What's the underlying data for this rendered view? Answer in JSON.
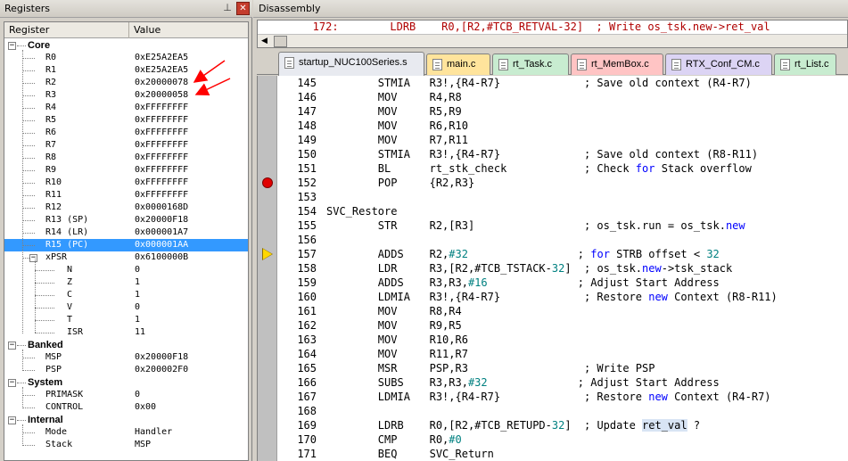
{
  "registers_panel": {
    "title": "Registers",
    "pin_icon": "pin-icon",
    "close_icon": "close-icon",
    "col_register": "Register",
    "col_value": "Value",
    "groups": [
      {
        "name": "Core",
        "expander": "−",
        "rows": [
          {
            "name": "R0",
            "value": "0xE25A2EA5"
          },
          {
            "name": "R1",
            "value": "0xE25A2EA5"
          },
          {
            "name": "R2",
            "value": "0x20000078"
          },
          {
            "name": "R3",
            "value": "0x20000058"
          },
          {
            "name": "R4",
            "value": "0xFFFFFFFF"
          },
          {
            "name": "R5",
            "value": "0xFFFFFFFF"
          },
          {
            "name": "R6",
            "value": "0xFFFFFFFF"
          },
          {
            "name": "R7",
            "value": "0xFFFFFFFF"
          },
          {
            "name": "R8",
            "value": "0xFFFFFFFF"
          },
          {
            "name": "R9",
            "value": "0xFFFFFFFF"
          },
          {
            "name": "R10",
            "value": "0xFFFFFFFF"
          },
          {
            "name": "R11",
            "value": "0xFFFFFFFF"
          },
          {
            "name": "R12",
            "value": "0x0000168D"
          },
          {
            "name": "R13 (SP)",
            "value": "0x20000F18"
          },
          {
            "name": "R14 (LR)",
            "value": "0x000001A7"
          },
          {
            "name": "R15 (PC)",
            "value": "0x000001AA",
            "selected": true
          },
          {
            "name": "xPSR",
            "value": "0x6100000B",
            "expander": "−"
          }
        ],
        "xpsr_bits": [
          {
            "name": "N",
            "value": "0"
          },
          {
            "name": "Z",
            "value": "1"
          },
          {
            "name": "C",
            "value": "1"
          },
          {
            "name": "V",
            "value": "0"
          },
          {
            "name": "T",
            "value": "1"
          },
          {
            "name": "ISR",
            "value": "11"
          }
        ]
      },
      {
        "name": "Banked",
        "expander": "−",
        "rows": [
          {
            "name": "MSP",
            "value": "0x20000F18"
          },
          {
            "name": "PSP",
            "value": "0x200002F0"
          }
        ]
      },
      {
        "name": "System",
        "expander": "−",
        "rows": [
          {
            "name": "PRIMASK",
            "value": "0"
          },
          {
            "name": "CONTROL",
            "value": "0x00"
          }
        ]
      },
      {
        "name": "Internal",
        "expander": "−",
        "rows": [
          {
            "name": "Mode",
            "value": "Handler"
          },
          {
            "name": "Stack",
            "value": "MSP"
          }
        ]
      }
    ],
    "annotation_color": "#ff0000"
  },
  "disassembly_panel": {
    "title": "Disassembly",
    "top_line": "   172:        LDRB    R0,[R2,#TCB_RETVAL-32]  ; Write os_tsk.new->ret_val",
    "tabs": [
      {
        "label": "startup_NUC100Series.s",
        "color": "#e8eaf0",
        "active": true
      },
      {
        "label": "main.c",
        "color": "#ffe49c"
      },
      {
        "label": "rt_Task.c",
        "color": "#c8ecd0"
      },
      {
        "label": "rt_MemBox.c",
        "color": "#ffc4c4"
      },
      {
        "label": "RTX_Conf_CM.c",
        "color": "#dcd4f4"
      },
      {
        "label": "rt_List.c",
        "color": "#c8ecd0"
      }
    ],
    "breakpoint_color": "#e00000",
    "current_line_color": "#ffd700",
    "lines": [
      {
        "n": "145",
        "code": [
          {
            "t": "        STMIA   R3!,{R4-R7}             ; Save old context (R4-R7)"
          }
        ]
      },
      {
        "n": "146",
        "code": [
          {
            "t": "        MOV     R4,R8"
          }
        ]
      },
      {
        "n": "147",
        "code": [
          {
            "t": "        MOV     R5,R9"
          }
        ]
      },
      {
        "n": "148",
        "code": [
          {
            "t": "        MOV     R6,R10"
          }
        ]
      },
      {
        "n": "149",
        "code": [
          {
            "t": "        MOV     R7,R11"
          }
        ]
      },
      {
        "n": "150",
        "code": [
          {
            "t": "        STMIA   R3!,{R4-R7}             ; Save old context (R8-R11)"
          }
        ]
      },
      {
        "n": "151",
        "code": [
          {
            "t": "        BL      rt_stk_check            ; Check "
          },
          {
            "t": "for",
            "c": "kw"
          },
          {
            "t": " Stack overflow"
          }
        ]
      },
      {
        "n": "152",
        "code": [
          {
            "t": "        POP     {R2,R3}"
          }
        ],
        "marker": "breakpoint"
      },
      {
        "n": "153",
        "code": [
          {
            "t": ""
          }
        ]
      },
      {
        "n": "154",
        "code": [
          {
            "t": "SVC_Restore"
          }
        ]
      },
      {
        "n": "155",
        "code": [
          {
            "t": "        STR     R2,[R3]                 ; os_tsk.run = os_tsk."
          },
          {
            "t": "new",
            "c": "kw"
          }
        ]
      },
      {
        "n": "156",
        "code": [
          {
            "t": ""
          }
        ]
      },
      {
        "n": "157",
        "code": [
          {
            "t": "        ADDS    R2,"
          },
          {
            "t": "#32",
            "c": "num"
          },
          {
            "t": "                 ; "
          },
          {
            "t": "for",
            "c": "kw"
          },
          {
            "t": " STRB offset < "
          },
          {
            "t": "32",
            "c": "num"
          }
        ],
        "marker": "current"
      },
      {
        "n": "158",
        "code": [
          {
            "t": "        LDR     R3,[R2,#TCB_TSTACK-"
          },
          {
            "t": "32",
            "c": "num"
          },
          {
            "t": "]  ; os_tsk."
          },
          {
            "t": "new",
            "c": "kw"
          },
          {
            "t": "->tsk_stack"
          }
        ]
      },
      {
        "n": "159",
        "code": [
          {
            "t": "        ADDS    R3,R3,"
          },
          {
            "t": "#16",
            "c": "num"
          },
          {
            "t": "              ; Adjust Start Address"
          }
        ]
      },
      {
        "n": "160",
        "code": [
          {
            "t": "        LDMIA   R3!,{R4-R7}             ; Restore "
          },
          {
            "t": "new",
            "c": "kw"
          },
          {
            "t": " Context (R8-R11)"
          }
        ]
      },
      {
        "n": "161",
        "code": [
          {
            "t": "        MOV     R8,R4"
          }
        ]
      },
      {
        "n": "162",
        "code": [
          {
            "t": "        MOV     R9,R5"
          }
        ]
      },
      {
        "n": "163",
        "code": [
          {
            "t": "        MOV     R10,R6"
          }
        ]
      },
      {
        "n": "164",
        "code": [
          {
            "t": "        MOV     R11,R7"
          }
        ]
      },
      {
        "n": "165",
        "code": [
          {
            "t": "        MSR     PSP,R3                  ; Write PSP"
          }
        ]
      },
      {
        "n": "166",
        "code": [
          {
            "t": "        SUBS    R3,R3,"
          },
          {
            "t": "#32",
            "c": "num"
          },
          {
            "t": "              ; Adjust Start Address"
          }
        ]
      },
      {
        "n": "167",
        "code": [
          {
            "t": "        LDMIA   R3!,{R4-R7}             ; Restore "
          },
          {
            "t": "new",
            "c": "kw"
          },
          {
            "t": " Context (R4-R7)"
          }
        ]
      },
      {
        "n": "168",
        "code": [
          {
            "t": ""
          }
        ]
      },
      {
        "n": "169",
        "code": [
          {
            "t": "        LDRB    R0,[R2,#TCB_RETUPD-"
          },
          {
            "t": "32",
            "c": "num"
          },
          {
            "t": "]  ; Update "
          },
          {
            "t": "ret_val",
            "c": "hl"
          },
          {
            "t": " ?"
          }
        ]
      },
      {
        "n": "170",
        "code": [
          {
            "t": "        CMP     R0,"
          },
          {
            "t": "#0",
            "c": "num"
          }
        ]
      },
      {
        "n": "171",
        "code": [
          {
            "t": "        BEQ     SVC_Return"
          }
        ]
      }
    ]
  }
}
